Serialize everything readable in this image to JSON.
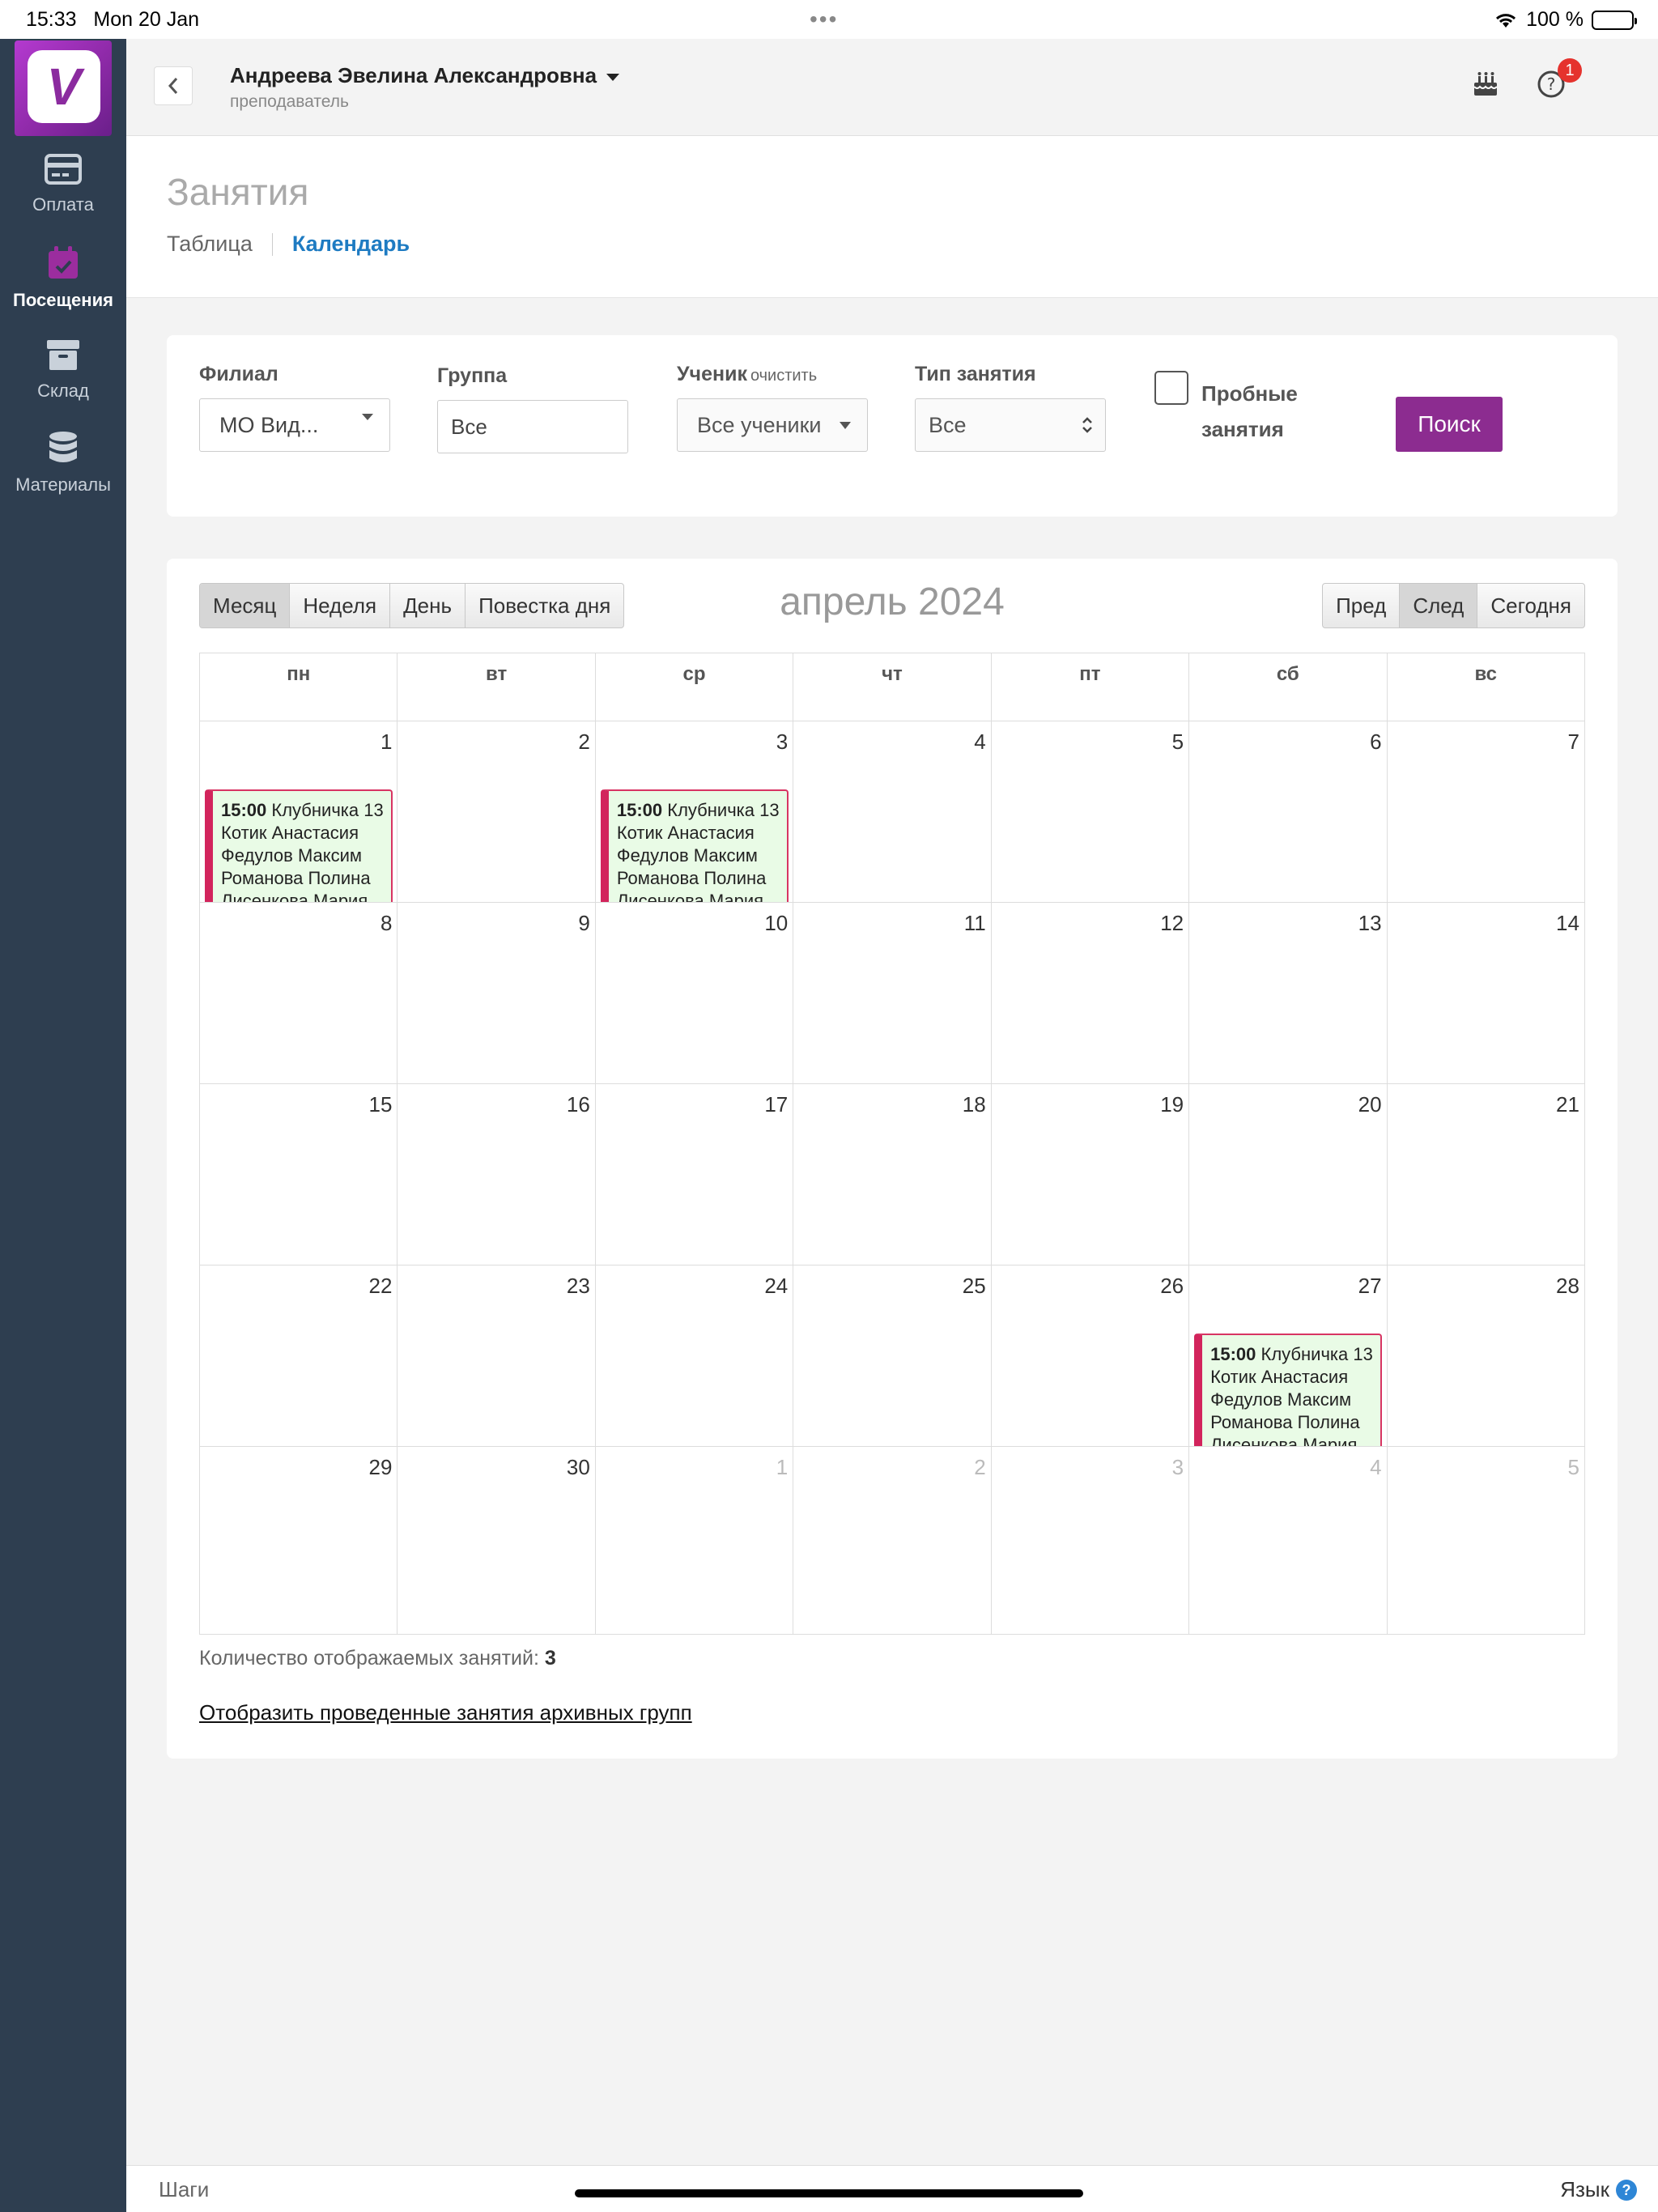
{
  "status_bar": {
    "time": "15:33",
    "date": "Mon 20 Jan",
    "battery": "100 %"
  },
  "sidebar": {
    "items": [
      {
        "label": "Оплата",
        "icon": "credit-card-icon"
      },
      {
        "label": "Посещения",
        "icon": "calendar-check-icon",
        "active": true
      },
      {
        "label": "Склад",
        "icon": "archive-box-icon"
      },
      {
        "label": "Материалы",
        "icon": "database-icon"
      }
    ]
  },
  "header": {
    "user_name": "Андреева Эвелина Александровна",
    "user_role": "преподаватель",
    "notifications": "1"
  },
  "page": {
    "title": "Занятия",
    "tabs": [
      {
        "label": "Таблица"
      },
      {
        "label": "Календарь",
        "active": true
      }
    ]
  },
  "filters": {
    "branch_label": "Филиал",
    "branch_value": "МО Вид...",
    "group_label": "Группа",
    "group_value": "Все",
    "student_label": "Ученик",
    "student_clear": "очистить",
    "student_value": "Все ученики",
    "type_label": "Тип занятия",
    "type_value": "Все",
    "trial_label": "Пробные занятия",
    "search_button": "Поиск"
  },
  "calendar": {
    "view_buttons": [
      "Месяц",
      "Неделя",
      "День",
      "Повестка дня"
    ],
    "active_view": "Месяц",
    "title": "апрель 2024",
    "nav_buttons": [
      "Пред",
      "След",
      "Сегодня"
    ],
    "weekdays": [
      "пн",
      "вт",
      "ср",
      "чт",
      "пт",
      "сб",
      "вс"
    ],
    "weeks": [
      [
        "1",
        "2",
        "3",
        "4",
        "5",
        "6",
        "7"
      ],
      [
        "8",
        "9",
        "10",
        "11",
        "12",
        "13",
        "14"
      ],
      [
        "15",
        "16",
        "17",
        "18",
        "19",
        "20",
        "21"
      ],
      [
        "22",
        "23",
        "24",
        "25",
        "26",
        "27",
        "28"
      ],
      [
        "29",
        "30",
        "1",
        "2",
        "3",
        "4",
        "5"
      ]
    ],
    "event": {
      "time": "15:00",
      "group": "Клубничка 13",
      "students": [
        "Котик Анастасия",
        "Федулов Максим",
        "Романова Полина",
        "Лисенкова Мария"
      ]
    },
    "event_days": [
      "1",
      "3",
      "27"
    ],
    "count_label": "Количество отображаемых занятий:",
    "count_value": "3",
    "archive_link": "Отобразить проведенные занятия архивных групп"
  },
  "footer": {
    "steps": "Шаги",
    "language": "Язык"
  },
  "colors": {
    "sidebar_bg": "#2e3e50",
    "accent": "#8c2c90",
    "link": "#1e7bc2",
    "event_border": "#d2245c",
    "event_bg": "#e9fbe6"
  }
}
